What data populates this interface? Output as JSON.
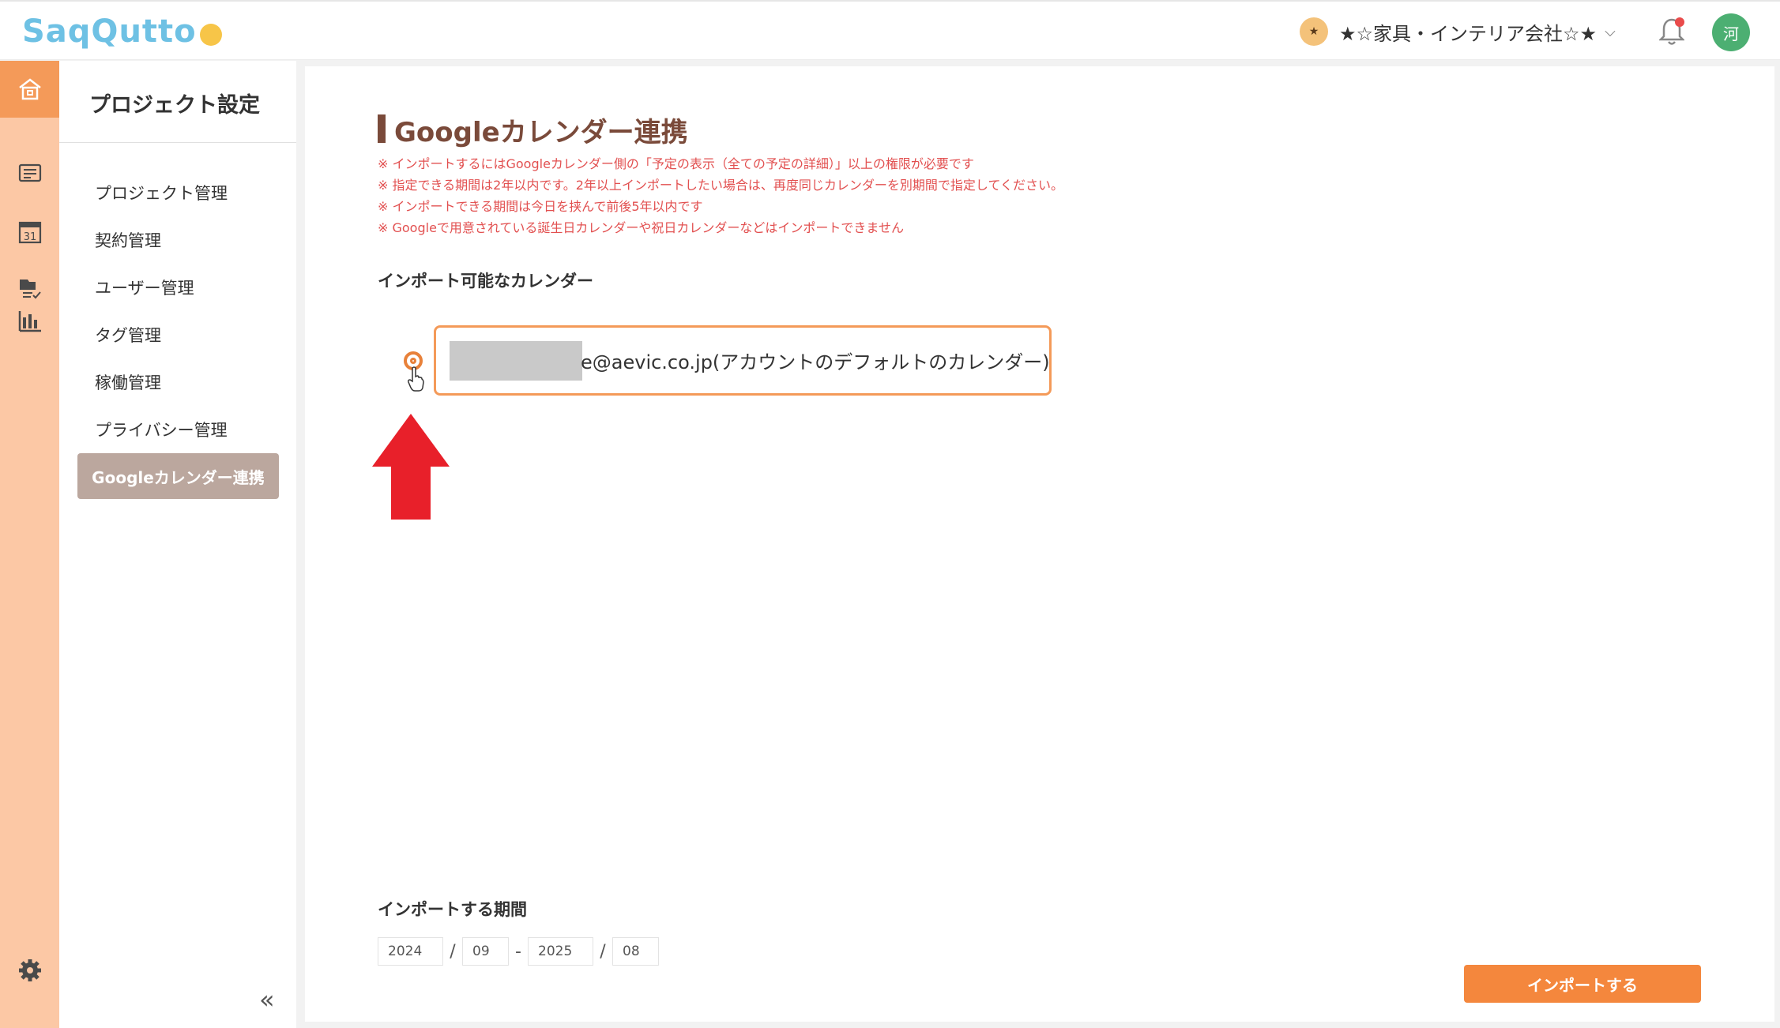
{
  "header": {
    "logo_text": "SaqQutto",
    "company_badge": "★",
    "company_name": "★☆家具・インテリア会社☆★",
    "avatar_initial": "河"
  },
  "rail": {
    "items": [
      {
        "icon": "home-icon"
      },
      {
        "icon": "list-icon"
      },
      {
        "icon": "calendar-icon",
        "label": "31"
      },
      {
        "icon": "file-check-icon"
      },
      {
        "icon": "chart-icon"
      }
    ]
  },
  "subnav": {
    "title": "プロジェクト設定",
    "items": [
      "プロジェクト管理",
      "契約管理",
      "ユーザー管理",
      "タグ管理",
      "稼働管理",
      "プライバシー管理"
    ],
    "active": "Googleカレンダー連携",
    "collapse": "«"
  },
  "main": {
    "title": "Googleカレンダー連携",
    "notes": [
      "※ インポートするにはGoogleカレンダー側の「予定の表示（全ての予定の詳細）」以上の権限が必要です",
      "※ 指定できる期間は2年以内です。2年以上インポートしたい場合は、再度同じカレンダーを別期間で指定してください。",
      "※ インポートできる期間は今日を挟んで前後5年以内です",
      "※ Googleで用意されている誕生日カレンダーや祝日カレンダーなどはインポートできません"
    ],
    "calendars_label": "インポート可能なカレンダー",
    "calendar_option": "e@aevic.co.jp(アカウントのデフォルトのカレンダー)",
    "period_label": "インポートする期間",
    "period": {
      "start_year": "2024",
      "start_month": "09",
      "end_year": "2025",
      "end_month": "08"
    },
    "import_button": "インポートする"
  },
  "colors": {
    "accent": "#f4873d",
    "rail_bg": "#fcc8a5",
    "title": "#7a4a3a",
    "note": "#e25050",
    "annotation_arrow": "#e8202a"
  }
}
